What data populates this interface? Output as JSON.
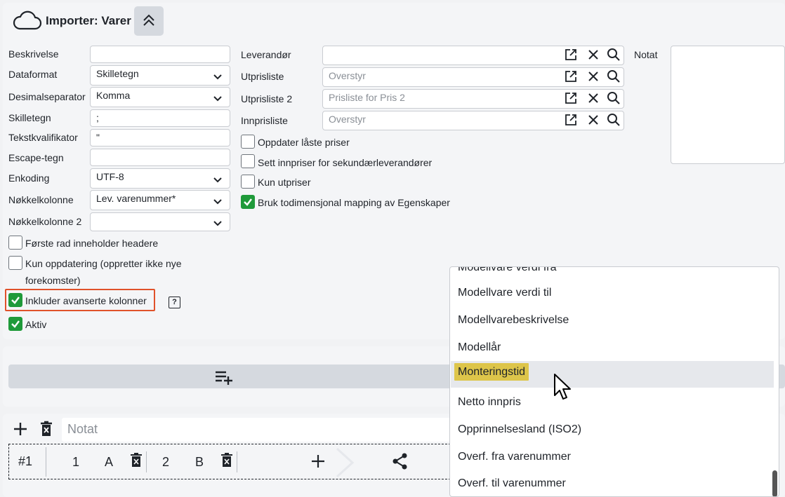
{
  "header": {
    "title": "Importer: Varer"
  },
  "left_fields": [
    {
      "label": "Beskrivelse",
      "value": ""
    },
    {
      "label": "Dataformat",
      "value": "Skilletegn"
    },
    {
      "label": "Desimalseparator",
      "value": "Komma"
    },
    {
      "label": "Skilletegn",
      "value": ";"
    },
    {
      "label": "Tekstkvalifikator",
      "value": "\""
    },
    {
      "label": "Escape-tegn",
      "value": ""
    },
    {
      "label": "Enkoding",
      "value": "UTF-8"
    },
    {
      "label": "Nøkkelkolonne",
      "value": "Lev. varenummer*"
    },
    {
      "label": "Nøkkelkolonne 2",
      "value": ""
    }
  ],
  "left_checkboxes": [
    {
      "label": "Første rad inneholder headere",
      "checked": false
    },
    {
      "label_line1": "Kun oppdatering (oppretter ikke nye",
      "label_line2": "forekomster)",
      "checked": false
    },
    {
      "label": "Inkluder avanserte kolonner",
      "checked": true,
      "help": "?"
    },
    {
      "label": "Aktiv",
      "checked": true
    }
  ],
  "mid_fields": [
    {
      "label": "Leverandør",
      "value": "",
      "placeholder": ""
    },
    {
      "label": "Utprisliste",
      "value": "",
      "placeholder": "Overstyr"
    },
    {
      "label": "Utprisliste 2",
      "value": "",
      "placeholder": "Prisliste for Pris 2"
    },
    {
      "label": "Innprisliste",
      "value": "",
      "placeholder": "Overstyr"
    }
  ],
  "mid_checkboxes": [
    {
      "label": "Oppdater låste priser",
      "checked": false
    },
    {
      "label": "Sett innpriser for sekundærleverandører",
      "checked": false
    },
    {
      "label": "Kun utpriser",
      "checked": false
    },
    {
      "label": "Bruk todimensjonal mapping av Egenskaper",
      "checked": true
    }
  ],
  "notat": {
    "label": "Notat",
    "value": ""
  },
  "bottom": {
    "notat_placeholder": "Notat",
    "row_id": "#1",
    "cols": [
      {
        "num": "1",
        "letter": "A"
      },
      {
        "num": "2",
        "letter": "B"
      }
    ]
  },
  "dropdown": {
    "items": [
      "Modellvare verdi fra",
      "Modellvare verdi til",
      "Modellvarebeskrivelse",
      "Modellår",
      "Monteringstid",
      "Netto innpris",
      "Opprinnelsesland (ISO2)",
      "Overf. fra varenummer",
      "Overf. til varenummer"
    ],
    "highlighted": "Monteringstid"
  },
  "colors": {
    "check_green": "#1f9a3a",
    "highlight": "#ddc54a",
    "focus_border": "#e0522a"
  }
}
